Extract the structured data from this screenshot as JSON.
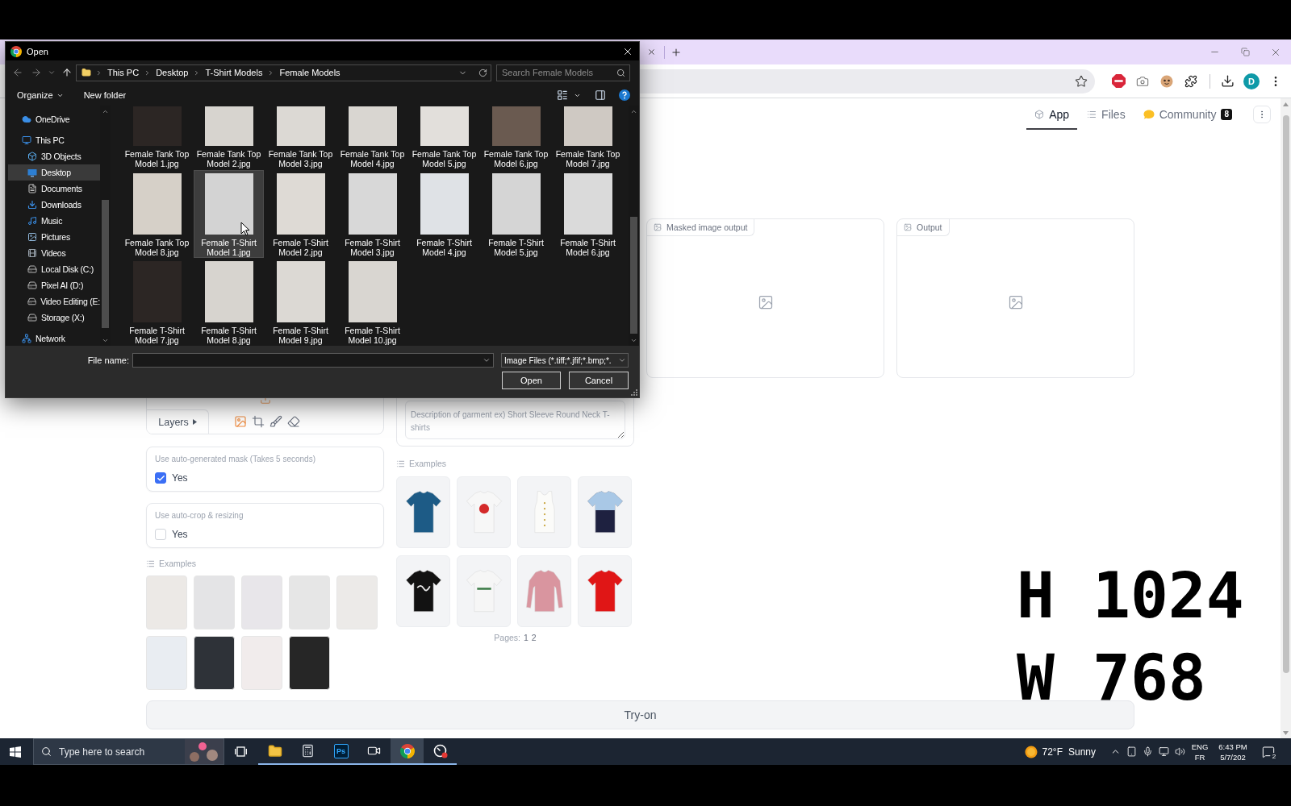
{
  "dialog": {
    "title": "Open",
    "path": [
      "This PC",
      "Desktop",
      "T-Shirt Models",
      "Female Models"
    ],
    "search": {
      "placeholder": "Search Female Models"
    },
    "commands": [
      {
        "label": "Organize",
        "menu": true
      },
      {
        "label": "New folder",
        "menu": false
      }
    ],
    "nav": [
      {
        "label": "OneDrive",
        "selected": false
      },
      {
        "label": "This PC",
        "selected": false,
        "children": [
          {
            "label": "3D Objects",
            "selected": false
          },
          {
            "label": "Desktop",
            "selected": true
          },
          {
            "label": "Documents",
            "selected": false
          },
          {
            "label": "Downloads",
            "selected": false
          },
          {
            "label": "Music",
            "selected": false
          },
          {
            "label": "Pictures",
            "selected": false
          },
          {
            "label": "Videos",
            "selected": false
          },
          {
            "label": "Local Disk (C:)",
            "selected": false
          },
          {
            "label": "Pixel AI (D:)",
            "selected": false
          },
          {
            "label": "Video Editing (E:",
            "selected": false
          },
          {
            "label": "Storage (X:)",
            "selected": false
          }
        ]
      },
      {
        "label": "Network",
        "selected": false
      }
    ],
    "files": [
      {
        "name": "Female Tank Top Model 1.jpg",
        "selected": false
      },
      {
        "name": "Female Tank Top Model 2.jpg",
        "selected": false
      },
      {
        "name": "Female Tank Top Model 3.jpg",
        "selected": false
      },
      {
        "name": "Female Tank Top Model 4.jpg",
        "selected": false
      },
      {
        "name": "Female Tank Top Model 5.jpg",
        "selected": false
      },
      {
        "name": "Female Tank Top Model 6.jpg",
        "selected": false
      },
      {
        "name": "Female Tank Top Model 7.jpg",
        "selected": false
      },
      {
        "name": "Female Tank Top Model 8.jpg",
        "selected": false
      },
      {
        "name": "Female T-Shirt Model 1.jpg",
        "selected": true
      },
      {
        "name": "Female T-Shirt Model 2.jpg",
        "selected": false
      },
      {
        "name": "Female T-Shirt Model 3.jpg",
        "selected": false
      },
      {
        "name": "Female T-Shirt Model 4.jpg",
        "selected": false
      },
      {
        "name": "Female T-Shirt Model 5.jpg",
        "selected": false
      },
      {
        "name": "Female T-Shirt Model 6.jpg",
        "selected": false
      },
      {
        "name": "Female T-Shirt Model 7.jpg",
        "selected": false
      },
      {
        "name": "Female T-Shirt Model 8.jpg",
        "selected": false
      },
      {
        "name": "Female T-Shirt Model 9.jpg",
        "selected": false
      },
      {
        "name": "Female T-Shirt Model 10.jpg",
        "selected": false
      }
    ],
    "file_name": {
      "label": "File name:"
    },
    "file_type": "Image Files (*.tiff;*.jfif;*.bmp;*.",
    "buttons": [
      "Open",
      "Cancel"
    ]
  },
  "browser": {
    "profile": "D"
  },
  "app": {
    "tabs": [
      {
        "label": "App",
        "selected": true
      },
      {
        "label": "Files",
        "selected": false
      },
      {
        "label": "Community",
        "selected": false,
        "badge": "8"
      }
    ],
    "person_panel": {
      "layers": "Layers",
      "options": [
        {
          "label": "Use auto-generated mask (Takes 5 seconds)",
          "option": "Yes",
          "checked": true
        },
        {
          "label": "Use auto-crop & resizing",
          "option": "Yes",
          "checked": false
        }
      ],
      "examples_title": "Examples"
    },
    "garment_panel": {
      "description": {
        "placeholder": "Description of garment ex) Short Sleeve Round Neck T-shirts"
      },
      "examples_title": "Examples",
      "pages_label": "Pages:",
      "pages": [
        "1",
        "2"
      ]
    },
    "outputs": [
      {
        "label": "Masked image output"
      },
      {
        "label": "Output"
      }
    ],
    "try_on": "Try-on"
  },
  "overlay": [
    "H 1024",
    "W 768"
  ],
  "taskbar": {
    "search": {
      "placeholder": "Type here to search"
    },
    "apps": [
      {
        "running": true,
        "selected": false
      },
      {
        "running": true,
        "selected": false
      },
      {
        "running": true,
        "selected": false,
        "label": "Ps"
      },
      {
        "running": true,
        "selected": false
      },
      {
        "running": true,
        "selected": true
      },
      {
        "running": true,
        "selected": false
      }
    ],
    "weather": {
      "temperature": "72°F",
      "condition": "Sunny"
    },
    "language": [
      "ENG",
      "FR"
    ],
    "time": "6:43 PM",
    "date": "5/7/202",
    "notifications": "2"
  }
}
